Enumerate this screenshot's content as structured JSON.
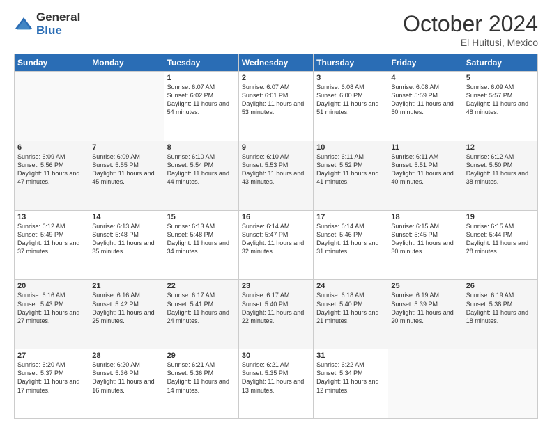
{
  "logo": {
    "general": "General",
    "blue": "Blue"
  },
  "header": {
    "month": "October 2024",
    "location": "El Huitusi, Mexico"
  },
  "weekdays": [
    "Sunday",
    "Monday",
    "Tuesday",
    "Wednesday",
    "Thursday",
    "Friday",
    "Saturday"
  ],
  "weeks": [
    [
      {
        "day": "",
        "sunrise": "",
        "sunset": "",
        "daylight": ""
      },
      {
        "day": "",
        "sunrise": "",
        "sunset": "",
        "daylight": ""
      },
      {
        "day": "1",
        "sunrise": "Sunrise: 6:07 AM",
        "sunset": "Sunset: 6:02 PM",
        "daylight": "Daylight: 11 hours and 54 minutes."
      },
      {
        "day": "2",
        "sunrise": "Sunrise: 6:07 AM",
        "sunset": "Sunset: 6:01 PM",
        "daylight": "Daylight: 11 hours and 53 minutes."
      },
      {
        "day": "3",
        "sunrise": "Sunrise: 6:08 AM",
        "sunset": "Sunset: 6:00 PM",
        "daylight": "Daylight: 11 hours and 51 minutes."
      },
      {
        "day": "4",
        "sunrise": "Sunrise: 6:08 AM",
        "sunset": "Sunset: 5:59 PM",
        "daylight": "Daylight: 11 hours and 50 minutes."
      },
      {
        "day": "5",
        "sunrise": "Sunrise: 6:09 AM",
        "sunset": "Sunset: 5:57 PM",
        "daylight": "Daylight: 11 hours and 48 minutes."
      }
    ],
    [
      {
        "day": "6",
        "sunrise": "Sunrise: 6:09 AM",
        "sunset": "Sunset: 5:56 PM",
        "daylight": "Daylight: 11 hours and 47 minutes."
      },
      {
        "day": "7",
        "sunrise": "Sunrise: 6:09 AM",
        "sunset": "Sunset: 5:55 PM",
        "daylight": "Daylight: 11 hours and 45 minutes."
      },
      {
        "day": "8",
        "sunrise": "Sunrise: 6:10 AM",
        "sunset": "Sunset: 5:54 PM",
        "daylight": "Daylight: 11 hours and 44 minutes."
      },
      {
        "day": "9",
        "sunrise": "Sunrise: 6:10 AM",
        "sunset": "Sunset: 5:53 PM",
        "daylight": "Daylight: 11 hours and 43 minutes."
      },
      {
        "day": "10",
        "sunrise": "Sunrise: 6:11 AM",
        "sunset": "Sunset: 5:52 PM",
        "daylight": "Daylight: 11 hours and 41 minutes."
      },
      {
        "day": "11",
        "sunrise": "Sunrise: 6:11 AM",
        "sunset": "Sunset: 5:51 PM",
        "daylight": "Daylight: 11 hours and 40 minutes."
      },
      {
        "day": "12",
        "sunrise": "Sunrise: 6:12 AM",
        "sunset": "Sunset: 5:50 PM",
        "daylight": "Daylight: 11 hours and 38 minutes."
      }
    ],
    [
      {
        "day": "13",
        "sunrise": "Sunrise: 6:12 AM",
        "sunset": "Sunset: 5:49 PM",
        "daylight": "Daylight: 11 hours and 37 minutes."
      },
      {
        "day": "14",
        "sunrise": "Sunrise: 6:13 AM",
        "sunset": "Sunset: 5:48 PM",
        "daylight": "Daylight: 11 hours and 35 minutes."
      },
      {
        "day": "15",
        "sunrise": "Sunrise: 6:13 AM",
        "sunset": "Sunset: 5:48 PM",
        "daylight": "Daylight: 11 hours and 34 minutes."
      },
      {
        "day": "16",
        "sunrise": "Sunrise: 6:14 AM",
        "sunset": "Sunset: 5:47 PM",
        "daylight": "Daylight: 11 hours and 32 minutes."
      },
      {
        "day": "17",
        "sunrise": "Sunrise: 6:14 AM",
        "sunset": "Sunset: 5:46 PM",
        "daylight": "Daylight: 11 hours and 31 minutes."
      },
      {
        "day": "18",
        "sunrise": "Sunrise: 6:15 AM",
        "sunset": "Sunset: 5:45 PM",
        "daylight": "Daylight: 11 hours and 30 minutes."
      },
      {
        "day": "19",
        "sunrise": "Sunrise: 6:15 AM",
        "sunset": "Sunset: 5:44 PM",
        "daylight": "Daylight: 11 hours and 28 minutes."
      }
    ],
    [
      {
        "day": "20",
        "sunrise": "Sunrise: 6:16 AM",
        "sunset": "Sunset: 5:43 PM",
        "daylight": "Daylight: 11 hours and 27 minutes."
      },
      {
        "day": "21",
        "sunrise": "Sunrise: 6:16 AM",
        "sunset": "Sunset: 5:42 PM",
        "daylight": "Daylight: 11 hours and 25 minutes."
      },
      {
        "day": "22",
        "sunrise": "Sunrise: 6:17 AM",
        "sunset": "Sunset: 5:41 PM",
        "daylight": "Daylight: 11 hours and 24 minutes."
      },
      {
        "day": "23",
        "sunrise": "Sunrise: 6:17 AM",
        "sunset": "Sunset: 5:40 PM",
        "daylight": "Daylight: 11 hours and 22 minutes."
      },
      {
        "day": "24",
        "sunrise": "Sunrise: 6:18 AM",
        "sunset": "Sunset: 5:40 PM",
        "daylight": "Daylight: 11 hours and 21 minutes."
      },
      {
        "day": "25",
        "sunrise": "Sunrise: 6:19 AM",
        "sunset": "Sunset: 5:39 PM",
        "daylight": "Daylight: 11 hours and 20 minutes."
      },
      {
        "day": "26",
        "sunrise": "Sunrise: 6:19 AM",
        "sunset": "Sunset: 5:38 PM",
        "daylight": "Daylight: 11 hours and 18 minutes."
      }
    ],
    [
      {
        "day": "27",
        "sunrise": "Sunrise: 6:20 AM",
        "sunset": "Sunset: 5:37 PM",
        "daylight": "Daylight: 11 hours and 17 minutes."
      },
      {
        "day": "28",
        "sunrise": "Sunrise: 6:20 AM",
        "sunset": "Sunset: 5:36 PM",
        "daylight": "Daylight: 11 hours and 16 minutes."
      },
      {
        "day": "29",
        "sunrise": "Sunrise: 6:21 AM",
        "sunset": "Sunset: 5:36 PM",
        "daylight": "Daylight: 11 hours and 14 minutes."
      },
      {
        "day": "30",
        "sunrise": "Sunrise: 6:21 AM",
        "sunset": "Sunset: 5:35 PM",
        "daylight": "Daylight: 11 hours and 13 minutes."
      },
      {
        "day": "31",
        "sunrise": "Sunrise: 6:22 AM",
        "sunset": "Sunset: 5:34 PM",
        "daylight": "Daylight: 11 hours and 12 minutes."
      },
      {
        "day": "",
        "sunrise": "",
        "sunset": "",
        "daylight": ""
      },
      {
        "day": "",
        "sunrise": "",
        "sunset": "",
        "daylight": ""
      }
    ]
  ]
}
